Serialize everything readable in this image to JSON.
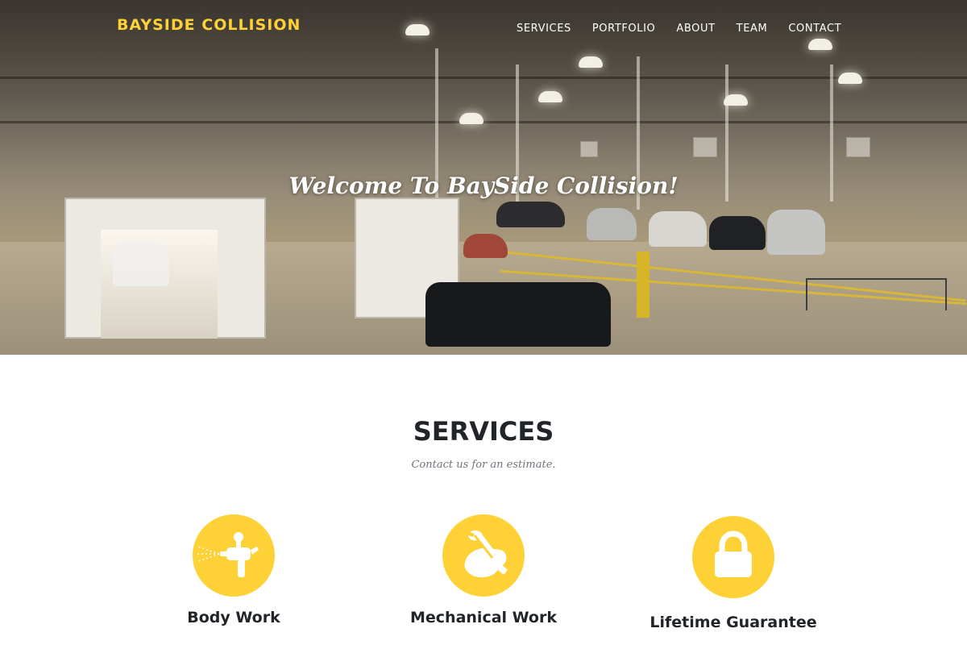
{
  "brand": "BAYSIDE COLLISION",
  "nav": {
    "items": [
      "SERVICES",
      "PORTFOLIO",
      "ABOUT",
      "TEAM",
      "CONTACT"
    ]
  },
  "hero": {
    "title": "Welcome To BaySide Collision!"
  },
  "services": {
    "heading": "SERVICES",
    "subheading": "Contact us for an estimate.",
    "items": [
      {
        "title": "Body Work",
        "icon": "spray-gun-icon"
      },
      {
        "title": "Mechanical Work",
        "icon": "wrench-hand-icon"
      },
      {
        "title": "Lifetime Guarantee",
        "icon": "lock-icon"
      }
    ]
  },
  "colors": {
    "accent": "#fed136",
    "heading": "#212529",
    "muted": "#6c757d"
  }
}
